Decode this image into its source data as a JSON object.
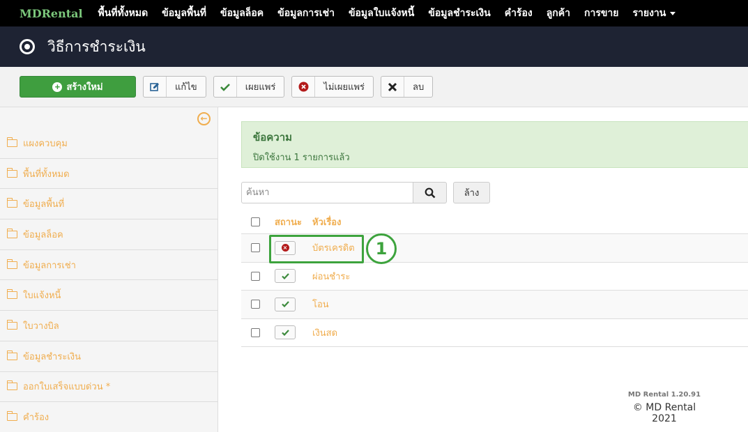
{
  "navbar": {
    "brand": "MDRental",
    "items": [
      "พื้นที่ทั้งหมด",
      "ข้อมูลพื้นที่",
      "ข้อมูลล็อค",
      "ข้อมูลการเช่า",
      "ข้อมูลใบแจ้งหนี้",
      "ข้อมูลชำระเงิน",
      "คำร้อง",
      "ลูกค้า",
      "การขาย",
      "รายงาน"
    ]
  },
  "header": {
    "title": "วิธีการชำระเงิน",
    "icon": "radio-circle-icon"
  },
  "toolbar": {
    "new_label": "สร้างใหม่",
    "edit_label": "แก้ไข",
    "publish_label": "เผยแพร่",
    "unpublish_label": "ไม่เผยแพร่",
    "delete_label": "ลบ"
  },
  "sidebar": {
    "items": [
      "แผงควบคุม",
      "พื้นที่ทั้งหมด",
      "ข้อมูลพื้นที่",
      "ข้อมูลล็อค",
      "ข้อมูลการเช่า",
      "ใบแจ้งหนี้",
      "ใบวางบิล",
      "ข้อมูลชำระเงิน",
      "ออกใบเสร็จแบบด่วน *",
      "คำร้อง"
    ]
  },
  "alert": {
    "title": "ข้อความ",
    "message": "ปิดใช้งาน 1 รายการแล้ว"
  },
  "search": {
    "placeholder": "ค้นหา",
    "clear_label": "ล้าง"
  },
  "table": {
    "headers": {
      "status": "สถานะ",
      "title": "หัวเรื่อง"
    },
    "rows": [
      {
        "title": "บัตรเครดิต",
        "published": false
      },
      {
        "title": "ผ่อนชำระ",
        "published": true
      },
      {
        "title": "โอน",
        "published": true
      },
      {
        "title": "เงินสด",
        "published": true
      }
    ]
  },
  "annotation": {
    "step": "1"
  },
  "footer": {
    "version": "MD Rental 1.20.91",
    "copyright": "© MD Rental 2021"
  },
  "colors": {
    "accent": "#f0ad4e",
    "success": "#3f9e3f",
    "navbar": "#000000",
    "header": "#1e2333"
  }
}
